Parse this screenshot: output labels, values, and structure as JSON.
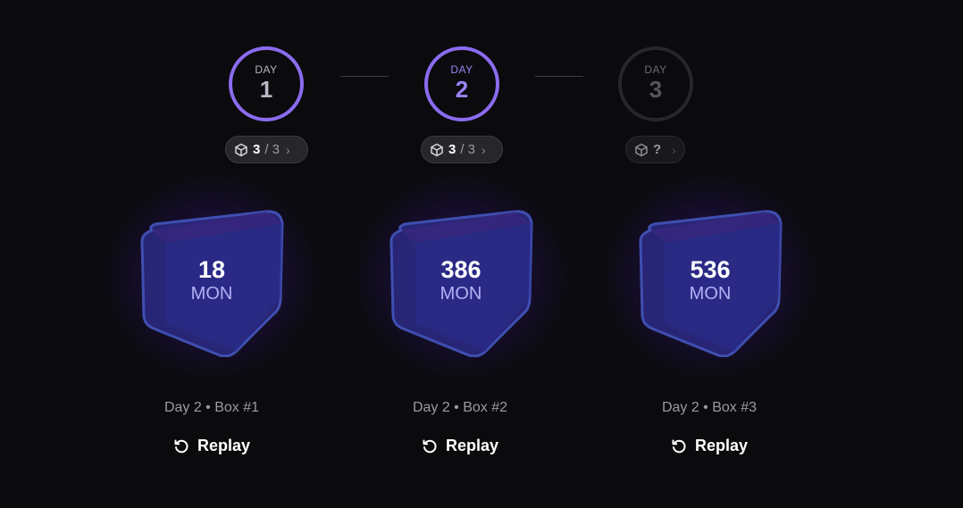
{
  "days": [
    {
      "caption": "DAY",
      "number": "1",
      "state": "done"
    },
    {
      "caption": "DAY",
      "number": "2",
      "state": "active"
    },
    {
      "caption": "DAY",
      "number": "3",
      "state": "locked"
    }
  ],
  "pills": [
    {
      "count": "3",
      "total": "/ 3",
      "icon": "cube-icon"
    },
    {
      "count": "3",
      "total": "/ 3",
      "icon": "cube-icon"
    },
    {
      "count": "?",
      "total": "",
      "icon": "cube-icon"
    }
  ],
  "boxes": [
    {
      "amount": "18",
      "unit": "MON",
      "label": "Day 2 • Box #1",
      "replay_label": "Replay"
    },
    {
      "amount": "386",
      "unit": "MON",
      "label": "Day 2 • Box #2",
      "replay_label": "Replay"
    },
    {
      "amount": "536",
      "unit": "MON",
      "label": "Day 2 • Box #3",
      "replay_label": "Replay"
    }
  ],
  "colors": {
    "accent": "#8b6cf0",
    "background": "#0b0b0e",
    "unit_text": "#b4b0f5"
  }
}
